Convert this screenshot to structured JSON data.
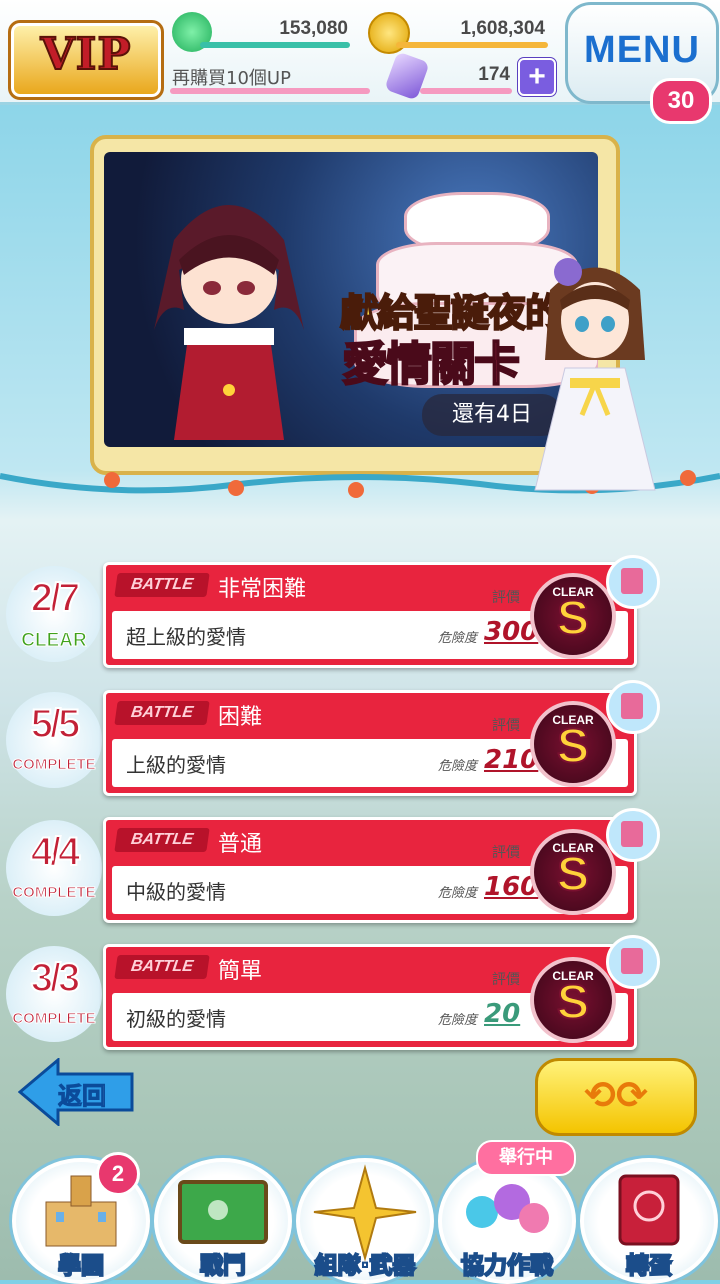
{
  "header": {
    "vip_label": "VIP",
    "tickets": "153,080",
    "coins": "1,608,304",
    "purchase_note": "再購買10個UP",
    "gems": "174",
    "menu_label": "MENU",
    "menu_badge": "30"
  },
  "banner": {
    "title_line1": "獻給聖誕夜的",
    "title_line2": "愛情關卡",
    "time_left": "還有4日"
  },
  "stages": [
    {
      "progress": "2/7",
      "progress_label": "CLEAR",
      "battle_label": "BATTLE",
      "difficulty": "非常困難",
      "name": "超上級的愛情",
      "eval_label": "評價",
      "danger_label": "危險度",
      "danger_value": "300",
      "badge_top": "CLEAR",
      "rank": "S"
    },
    {
      "progress": "5/5",
      "progress_label": "COMPLETE",
      "battle_label": "BATTLE",
      "difficulty": "困難",
      "name": "上級的愛情",
      "eval_label": "評價",
      "danger_label": "危險度",
      "danger_value": "210",
      "badge_top": "CLEAR",
      "rank": "S"
    },
    {
      "progress": "4/4",
      "progress_label": "COMPLETE",
      "battle_label": "BATTLE",
      "difficulty": "普通",
      "name": "中級的愛情",
      "eval_label": "評價",
      "danger_label": "危險度",
      "danger_value": "160",
      "badge_top": "CLEAR",
      "rank": "S"
    },
    {
      "progress": "3/3",
      "progress_label": "COMPLETE",
      "battle_label": "BATTLE",
      "difficulty": "簡單",
      "name": "初級的愛情",
      "eval_label": "評價",
      "danger_label": "危險度",
      "danger_value": "20",
      "badge_top": "CLEAR",
      "rank": "S"
    }
  ],
  "controls": {
    "back_label": "返回",
    "swap_icon": "swap-arrows-icon"
  },
  "nav": {
    "school": "學園",
    "school_badge": "2",
    "battle": "戰鬥",
    "team": "組隊·武器",
    "coop": "協力作戰",
    "coop_event": "舉行中",
    "gacha": "轉蛋"
  },
  "colors": {
    "accent_red": "#e8243e",
    "menu_blue": "#1b6fcf",
    "badge_pink": "#e8386e",
    "gold": "#f4c400"
  }
}
